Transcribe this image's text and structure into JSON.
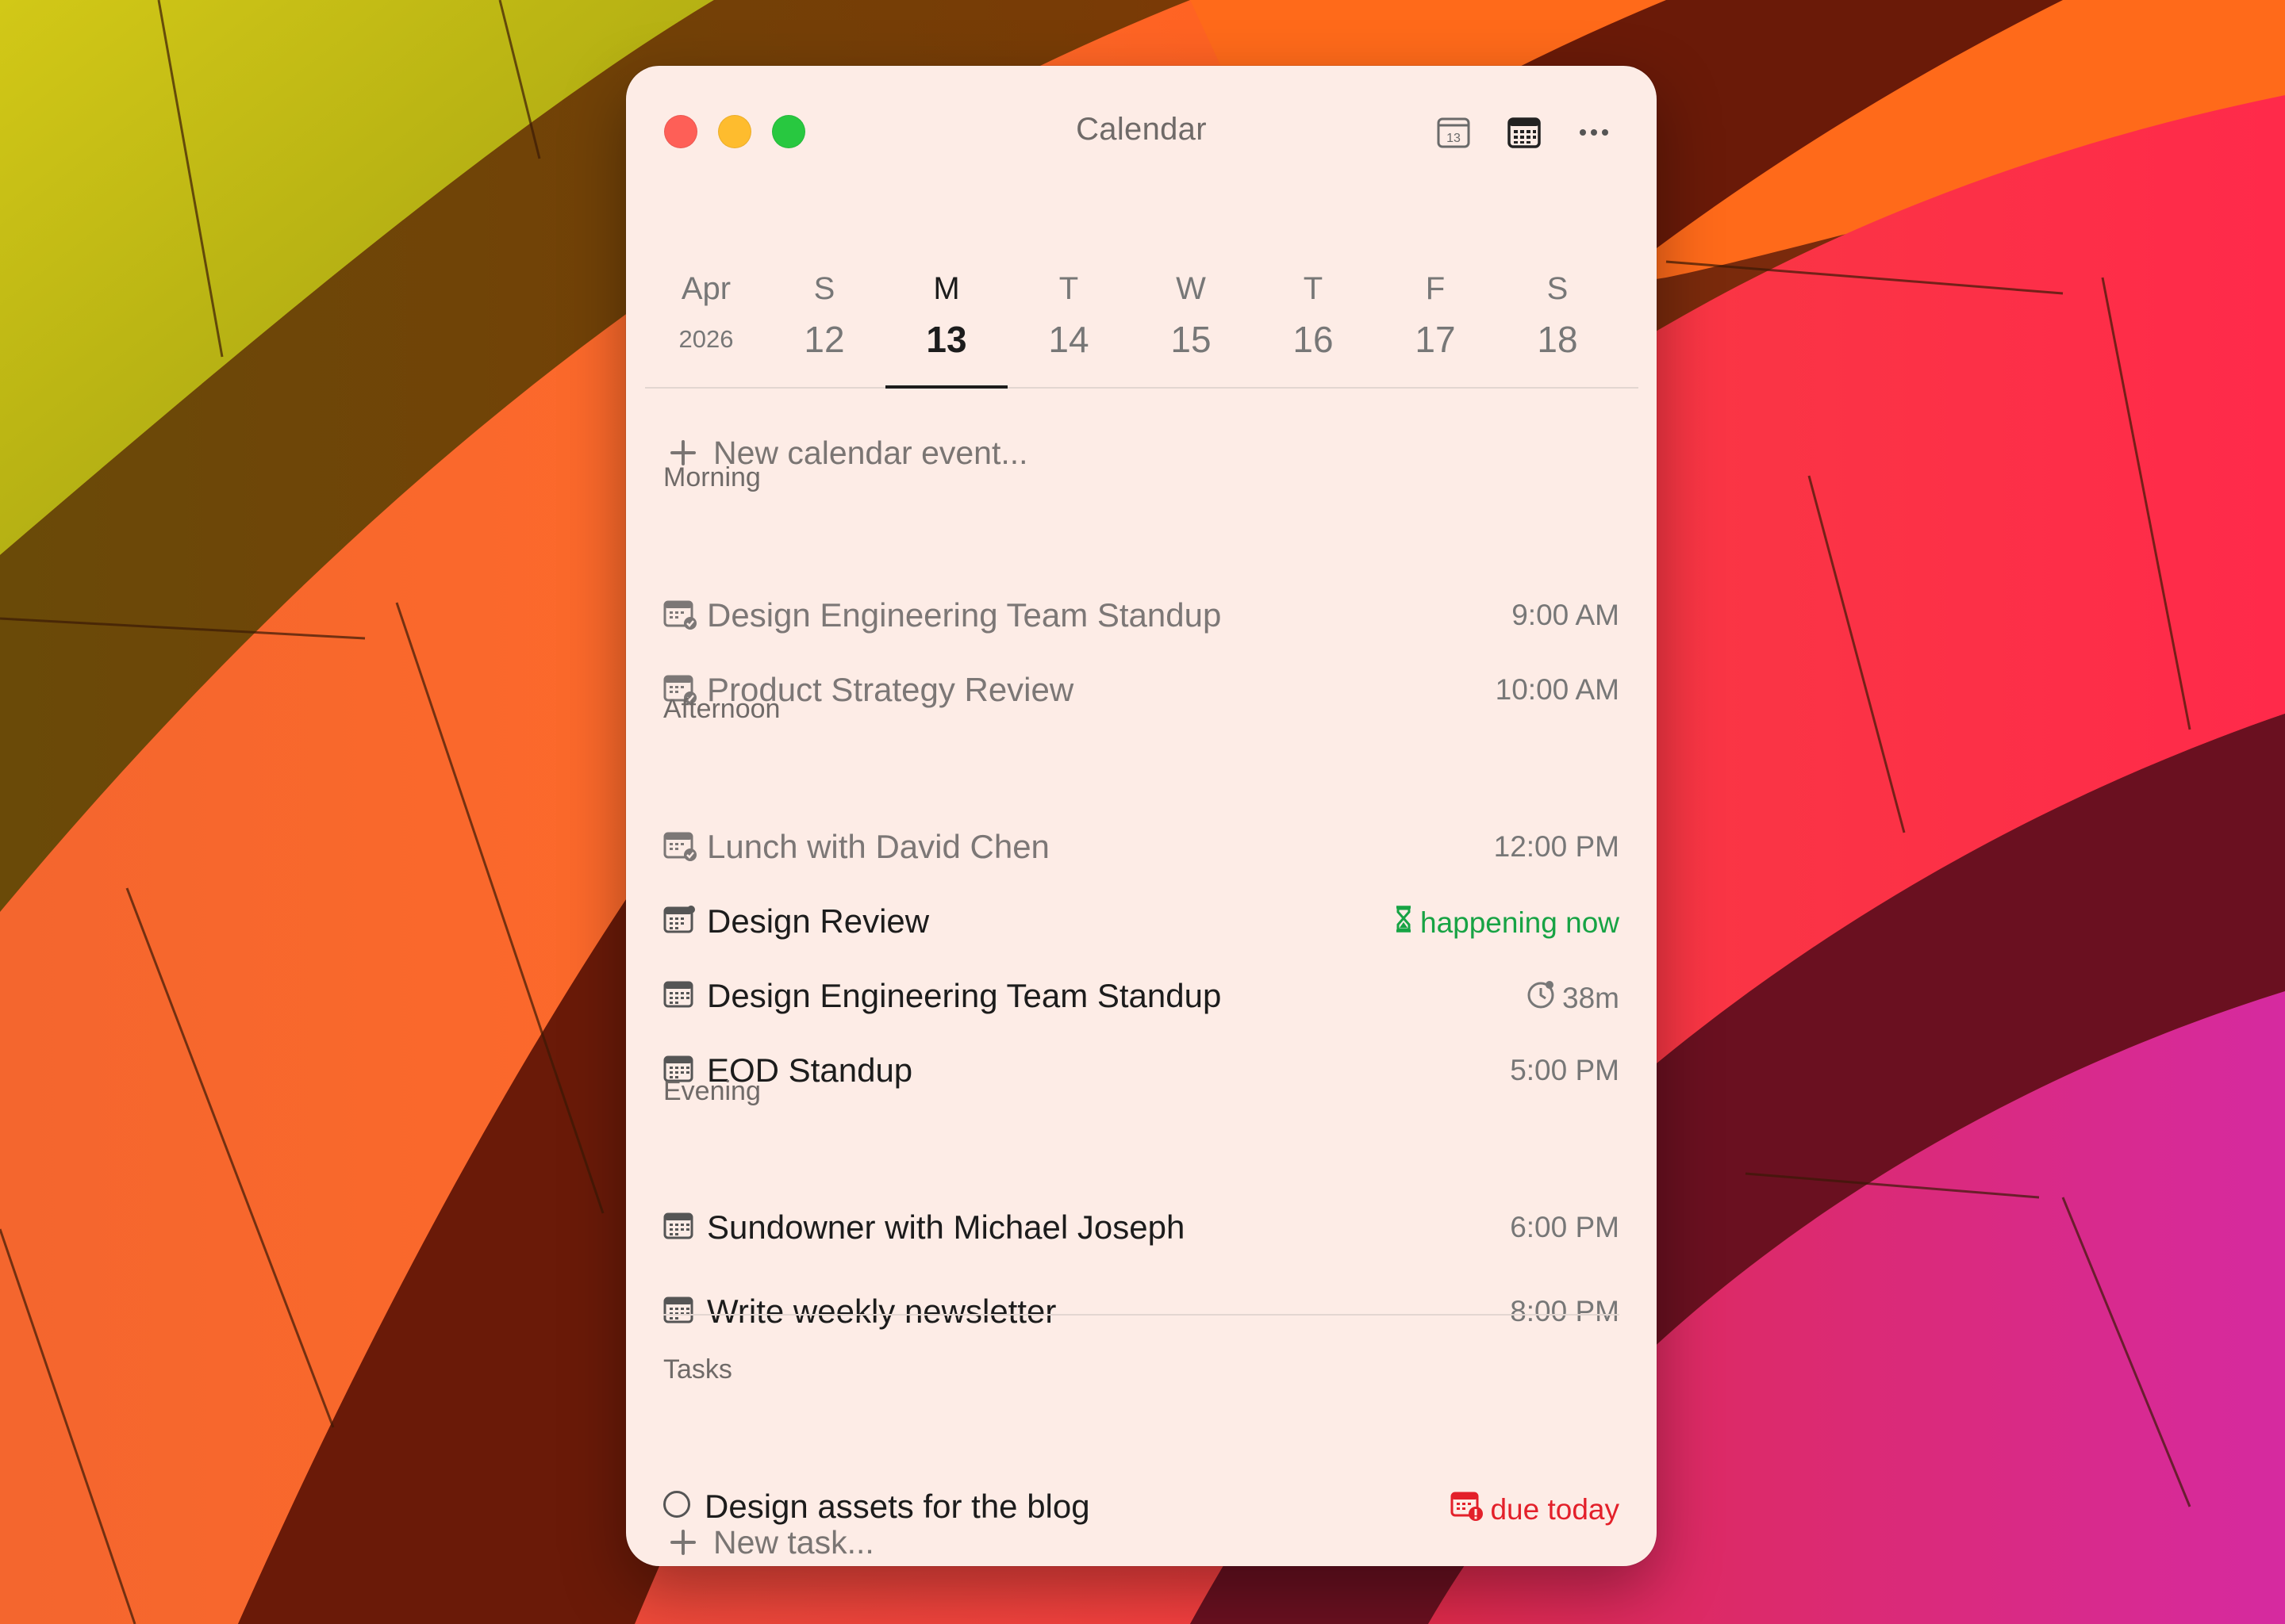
{
  "window": {
    "title": "Calendar"
  },
  "toolbar": {
    "today_icon": "calendar-day-icon",
    "today_label": "13",
    "month_icon": "calendar-grid-icon",
    "more_icon": "ellipsis-icon"
  },
  "week": {
    "month": "Apr",
    "year": "2026",
    "days": [
      {
        "dow": "S",
        "num": "12",
        "selected": false
      },
      {
        "dow": "M",
        "num": "13",
        "selected": true
      },
      {
        "dow": "T",
        "num": "14",
        "selected": false
      },
      {
        "dow": "W",
        "num": "15",
        "selected": false
      },
      {
        "dow": "T",
        "num": "16",
        "selected": false
      },
      {
        "dow": "F",
        "num": "17",
        "selected": false
      },
      {
        "dow": "S",
        "num": "18",
        "selected": false
      }
    ]
  },
  "new_event": {
    "label": "New calendar event..."
  },
  "sections": {
    "morning": "Morning",
    "afternoon": "Afternoon",
    "evening": "Evening",
    "tasks": "Tasks"
  },
  "events": {
    "morning": [
      {
        "name": "Design Engineering Team Standup",
        "time": "9:00 AM",
        "state": "past"
      },
      {
        "name": "Product Strategy Review",
        "time": "10:00 AM",
        "state": "past"
      }
    ],
    "afternoon": [
      {
        "name": "Lunch with David Chen",
        "time": "12:00 PM",
        "state": "past"
      },
      {
        "name": "Design Review",
        "time": "happening now",
        "state": "now"
      },
      {
        "name": "Design Engineering Team Standup",
        "time": "38m",
        "state": "upcoming"
      },
      {
        "name": "EOD Standup",
        "time": "5:00 PM",
        "state": "future"
      }
    ],
    "evening": [
      {
        "name": "Sundowner with Michael Joseph",
        "time": "6:00 PM",
        "state": "future"
      },
      {
        "name": "Write weekly newsletter",
        "time": "8:00 PM",
        "state": "future"
      }
    ]
  },
  "tasks": [
    {
      "name": "Design assets for the blog",
      "due": "due today"
    }
  ],
  "new_task": {
    "label": "New task..."
  },
  "colors": {
    "window_bg": "#fdece6",
    "accent_now": "#17a344",
    "accent_due": "#e3202a",
    "close": "#fe5f57",
    "minimize": "#febc2e",
    "maximize": "#28c840"
  }
}
